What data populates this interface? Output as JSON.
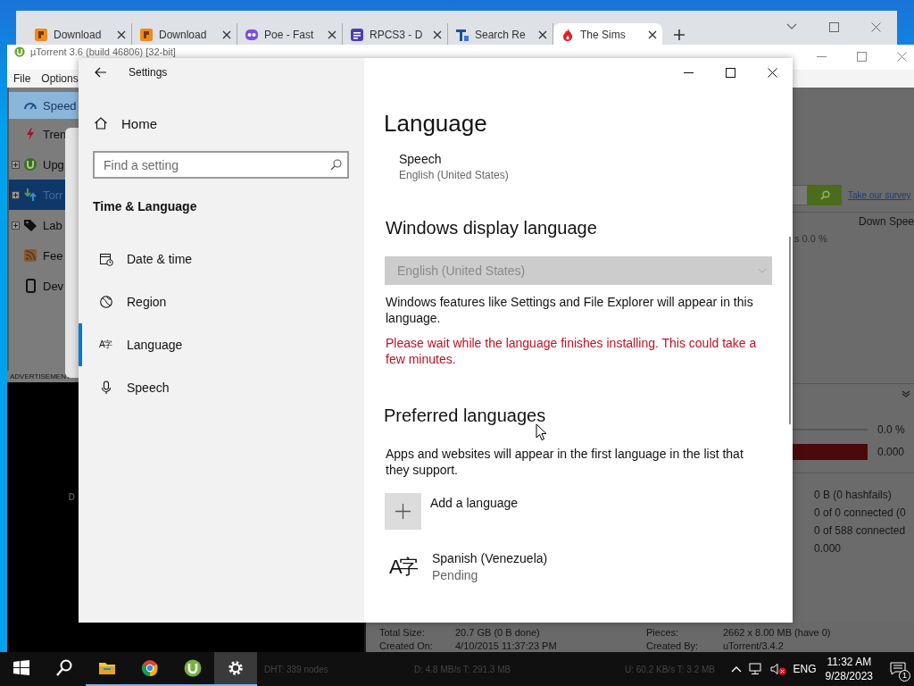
{
  "browser": {
    "tabs": [
      {
        "title": "Download",
        "kind": "r-logo",
        "selected": false
      },
      {
        "title": "Download",
        "kind": "r-logo",
        "selected": false
      },
      {
        "title": "Poe - Fast",
        "kind": "robot",
        "selected": false
      },
      {
        "title": "RPCS3 - D",
        "kind": "doc",
        "selected": false
      },
      {
        "title": "Search Re",
        "kind": "t-logo",
        "selected": false
      },
      {
        "title": "The Sims",
        "kind": "flame",
        "selected": true
      }
    ]
  },
  "utorrent": {
    "title": "µTorrent 3.6  (build 46806) [32-bit]",
    "menu": [
      "File",
      "Options"
    ],
    "sidebar": [
      {
        "label": "Speed",
        "kind": "speed",
        "highlighted": true,
        "selected": false,
        "expandable": false
      },
      {
        "label": "Tren",
        "kind": "trend",
        "highlighted": false,
        "selected": false,
        "expandable": false
      },
      {
        "label": "Upg",
        "kind": "upgrade",
        "highlighted": false,
        "selected": false,
        "expandable": true
      },
      {
        "label": "Torr",
        "kind": "torrents",
        "highlighted": false,
        "selected": true,
        "expandable": true
      },
      {
        "label": "Lab",
        "kind": "labels",
        "highlighted": false,
        "selected": false,
        "expandable": true
      },
      {
        "label": "Fee",
        "kind": "feeds",
        "highlighted": false,
        "selected": false,
        "expandable": false
      },
      {
        "label": "Dev",
        "kind": "devices",
        "highlighted": false,
        "selected": false,
        "expandable": false
      }
    ],
    "advertisement_label": "ADVERTISEMENT",
    "ad_text": "D",
    "survey_link": "Take our survey",
    "column_header": "Down Spee",
    "progress_fragment": "s 0.0 %",
    "bars": [
      {
        "level": 0,
        "reading": "0.0 %",
        "kind": "line"
      },
      {
        "level": 1,
        "reading": "0.000",
        "kind": "availability"
      }
    ],
    "transfer_values": [
      "0 B (0 hashfails)",
      "0 of 0 connected (0",
      "0 of 588 connected",
      "0.000"
    ],
    "general": [
      {
        "label": "Total Size:",
        "value": "20.7 GB (0 B done)"
      },
      {
        "label": "Pieces:",
        "value": "2662 x 8.00 MB (have 0)"
      },
      {
        "label": "Created On:",
        "value": "4/10/2015 11:37:23 PM"
      },
      {
        "label": "Created By:",
        "value": "uTorrent/3.4.2"
      }
    ],
    "status_bar": [
      "DHT: 339 nodes",
      "D: 4.8 MB/s T: 291.3 MB",
      "U: 60.2 KB/s T: 3.2 MB"
    ]
  },
  "settings": {
    "title": "Settings",
    "home": "Home",
    "search_placeholder": "Find a setting",
    "section": "Time & Language",
    "nav": [
      {
        "label": "Date & time",
        "kind": "clock",
        "selected": false
      },
      {
        "label": "Region",
        "kind": "globe",
        "selected": false
      },
      {
        "label": "Language",
        "kind": "language",
        "glyph": "A字",
        "selected": true
      },
      {
        "label": "Speech",
        "kind": "mic",
        "selected": false
      }
    ],
    "page": {
      "heading": "Language",
      "speech": {
        "title": "Speech",
        "value": "English (United States)"
      },
      "display_language": {
        "heading": "Windows display language",
        "dropdown": {
          "value": "English (United States)",
          "disabled": true
        },
        "description": "Windows features like Settings and File Explorer will appear in this language.",
        "warning": "Please wait while the language finishes installing. This could take a few minutes."
      },
      "preferred": {
        "heading": "Preferred languages",
        "description": "Apps and websites will appear in the first language in the list that they support.",
        "add_button": "Add a language",
        "languages": [
          {
            "glyph": "A字",
            "name": "Spanish (Venezuela)",
            "status": "Pending"
          }
        ]
      }
    }
  },
  "taskbar": {
    "apps": [
      {
        "kind": "start",
        "open": false,
        "active": false
      },
      {
        "kind": "search",
        "open": false,
        "active": false
      },
      {
        "kind": "explorer",
        "open": true,
        "active": false
      },
      {
        "kind": "chrome",
        "open": true,
        "active": false
      },
      {
        "kind": "utorrent",
        "open": true,
        "active": false
      },
      {
        "kind": "settings",
        "open": true,
        "active": true
      }
    ],
    "volume_muted": true,
    "language": "ENG",
    "time": "11:32 AM",
    "date": "9/28/2023",
    "notification_count": "1"
  }
}
